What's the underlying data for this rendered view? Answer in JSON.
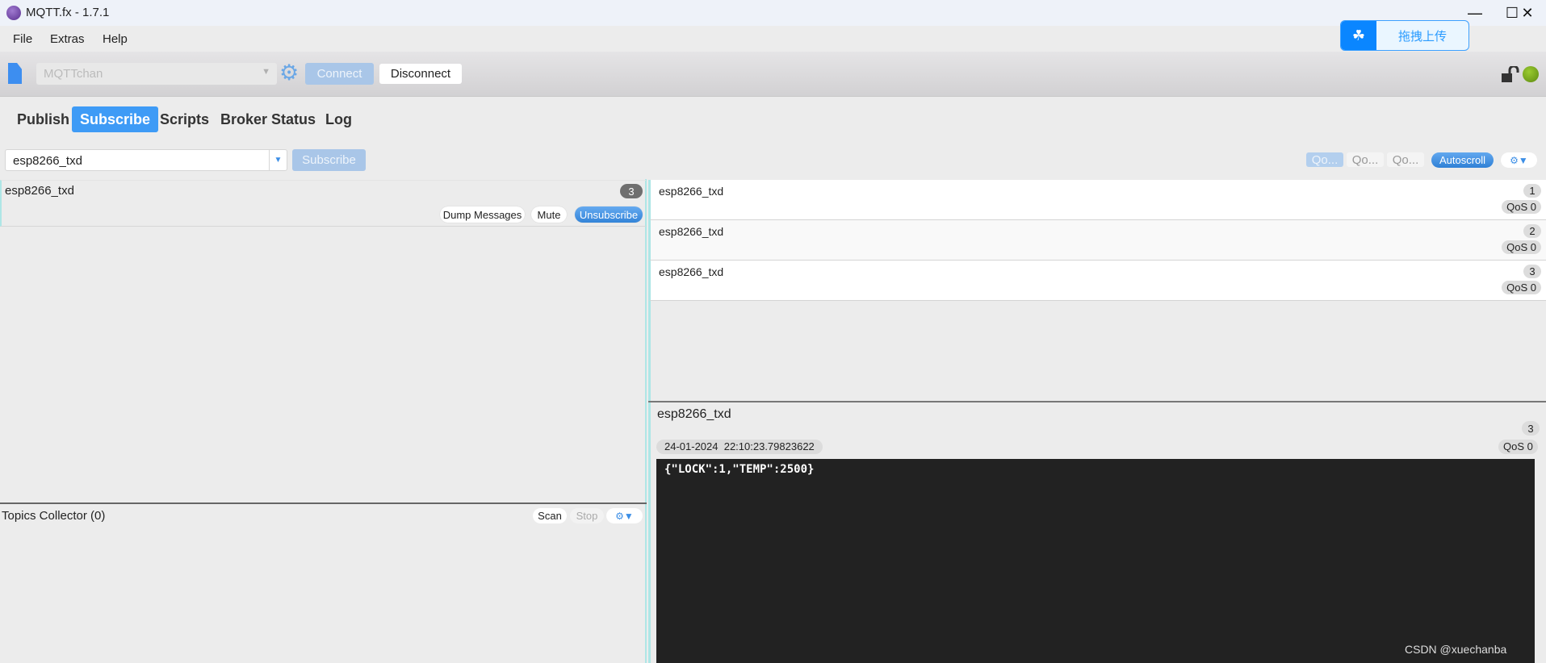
{
  "window": {
    "title": "MQTT.fx - 1.7.1",
    "minimize": "—",
    "maximize": "☐",
    "close": "✕"
  },
  "menu": [
    "File",
    "Extras",
    "Help"
  ],
  "overlay": {
    "upload_label": "拖拽上传",
    "icon": "baidu-cloud-icon"
  },
  "toolbar": {
    "profile": "MQTTchan",
    "connect": "Connect",
    "disconnect": "Disconnect",
    "connected": true,
    "status_color": "#7fb21f"
  },
  "tabs": [
    {
      "label": "Publish"
    },
    {
      "label": "Subscribe",
      "active": true
    },
    {
      "label": "Scripts"
    },
    {
      "label": "Broker Status"
    },
    {
      "label": "Log"
    }
  ],
  "subscribe": {
    "topic": "esp8266_txd",
    "button": "Subscribe",
    "qos_buttons": [
      "Qo...",
      "Qo...",
      "Qo..."
    ],
    "autoscroll": "Autoscroll"
  },
  "subscription": {
    "topic": "esp8266_txd",
    "count": "3",
    "dump": "Dump Messages",
    "mute": "Mute",
    "unsubscribe": "Unsubscribe"
  },
  "topics_collector": {
    "title": "Topics Collector (0)",
    "scan": "Scan",
    "stop": "Stop"
  },
  "messages": [
    {
      "topic": "esp8266_txd",
      "num": "1",
      "qos": "QoS 0"
    },
    {
      "topic": "esp8266_txd",
      "num": "2",
      "qos": "QoS 0"
    },
    {
      "topic": "esp8266_txd",
      "num": "3",
      "qos": "QoS 0"
    }
  ],
  "detail": {
    "topic": "esp8266_txd",
    "num": "3",
    "timestamp": "24-01-2024  22:10:23.79823622",
    "qos": "QoS 0",
    "payload": "{\"LOCK\":1,\"TEMP\":2500}"
  },
  "watermark": "CSDN @xuechanba"
}
